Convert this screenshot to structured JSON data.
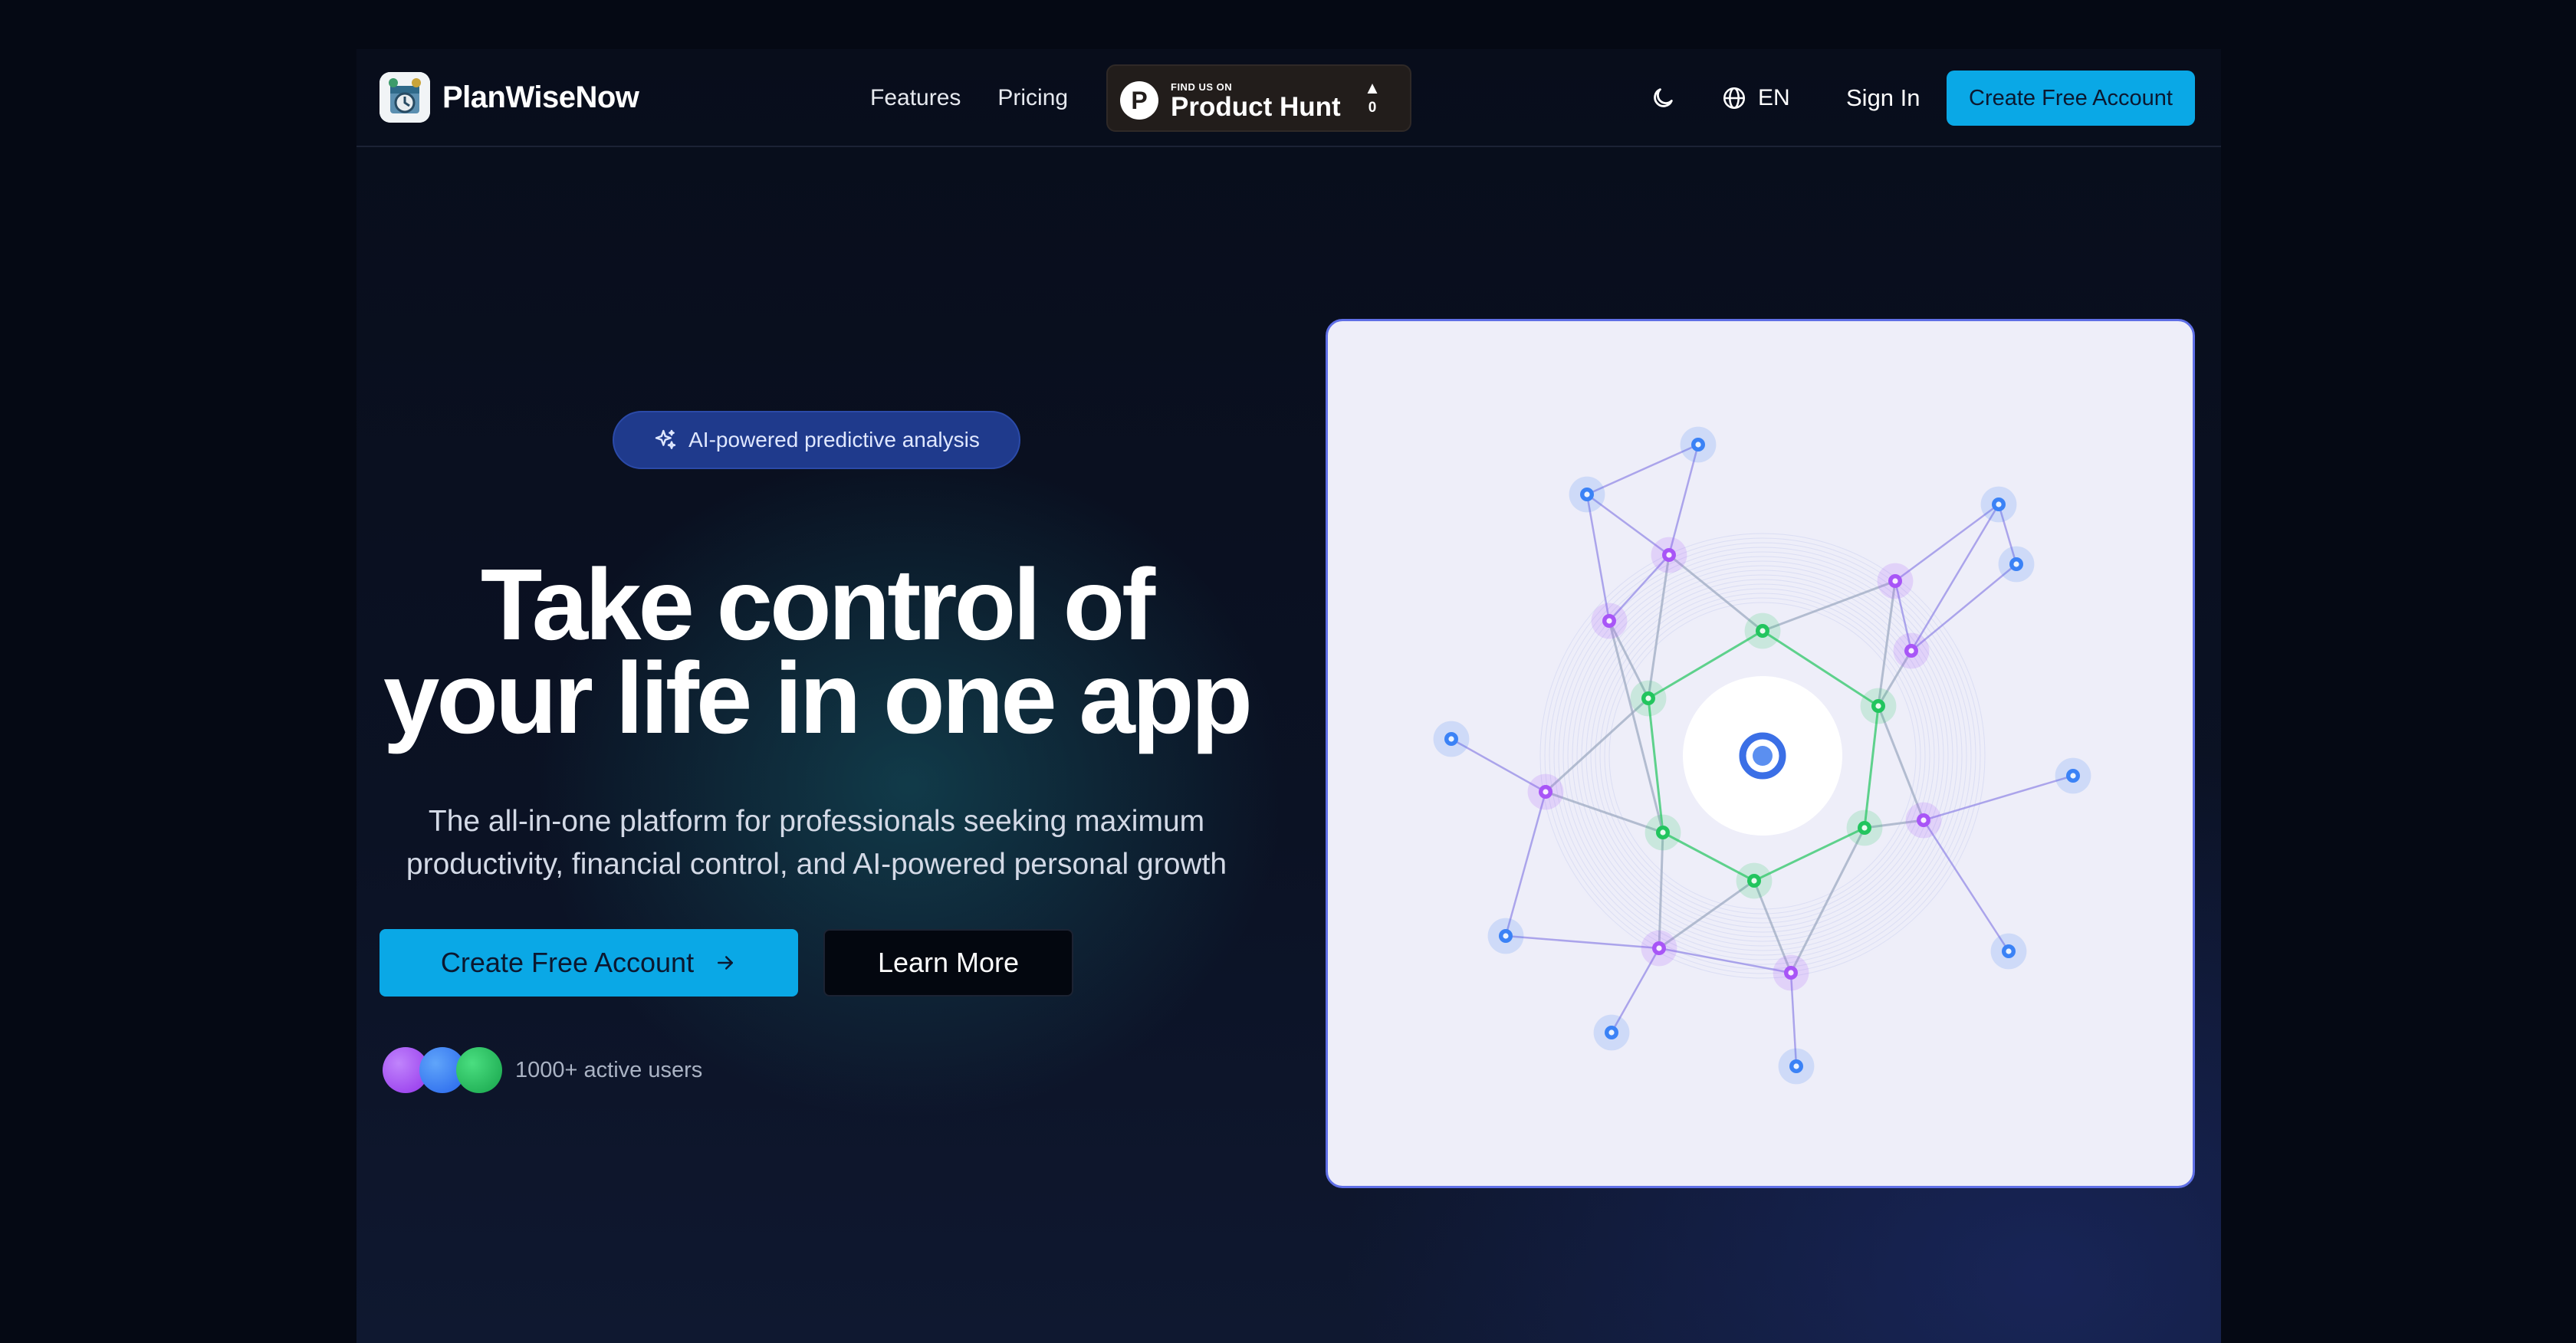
{
  "header": {
    "brand_name": "PlanWiseNow",
    "nav": [
      "Features",
      "Pricing"
    ],
    "product_hunt": {
      "small_label": "FIND US ON",
      "big_label": "Product Hunt",
      "letter": "P",
      "vote_arrow": "▲",
      "vote_count": "0"
    },
    "theme_icon": "moon-icon",
    "language": {
      "icon": "globe-icon",
      "label": "EN"
    },
    "sign_in": "Sign In",
    "cta": "Create Free Account"
  },
  "hero": {
    "pill": {
      "icon": "sparkles-icon",
      "label": "AI-powered predictive analysis"
    },
    "title_line1": "Take control of",
    "title_line2": "your life in one app",
    "subtitle": "The all-in-one platform for professionals seeking maximum productivity, financial control, and AI-powered personal growth",
    "cta_primary": "Create Free Account",
    "cta_primary_icon": "arrow-right-icon",
    "cta_secondary": "Learn More",
    "social_proof": "1000+ active users",
    "avatar_colors": [
      "#a855f7",
      "#3b82f6",
      "#22c55e"
    ]
  },
  "colors": {
    "accent": "#0aa8e6",
    "pill_bg": "#1f3a8c",
    "card_bg": "#eeeef9",
    "node_blue": "#3b82f6",
    "node_purple": "#a855f7",
    "node_green": "#22c55e"
  }
}
